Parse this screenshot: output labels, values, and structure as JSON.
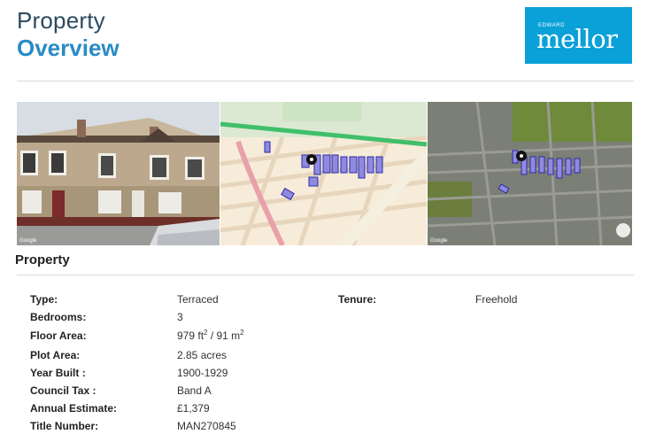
{
  "header": {
    "title_line1": "Property",
    "title_line2": "Overview"
  },
  "logo": {
    "small_text": "EDWARD",
    "big_text": "mellor",
    "bg_color": "#0aa0d8"
  },
  "images": [
    {
      "name": "street-photo",
      "watermark": "Google"
    },
    {
      "name": "street-map"
    },
    {
      "name": "satellite-map",
      "watermark": "Google"
    }
  ],
  "section": {
    "title": "Property"
  },
  "details": {
    "type_label": "Type:",
    "type_value": "Terraced",
    "tenure_label": "Tenure:",
    "tenure_value": "Freehold",
    "bedrooms_label": "Bedrooms:",
    "bedrooms_value": "3",
    "floor_area_label": "Floor Area:",
    "floor_area_ft": "979 ft",
    "floor_area_sep": " / 91 m",
    "area_sup": "2",
    "plot_area_label": "Plot Area:",
    "plot_area_value": "2.85 acres",
    "year_built_label": "Year Built :",
    "year_built_value": "1900-1929",
    "council_tax_label": "Council Tax :",
    "council_tax_value": "Band A",
    "annual_estimate_label": "Annual Estimate:",
    "annual_estimate_value": "£1,379",
    "title_number_label": "Title Number:",
    "title_number_value": "MAN270845"
  }
}
